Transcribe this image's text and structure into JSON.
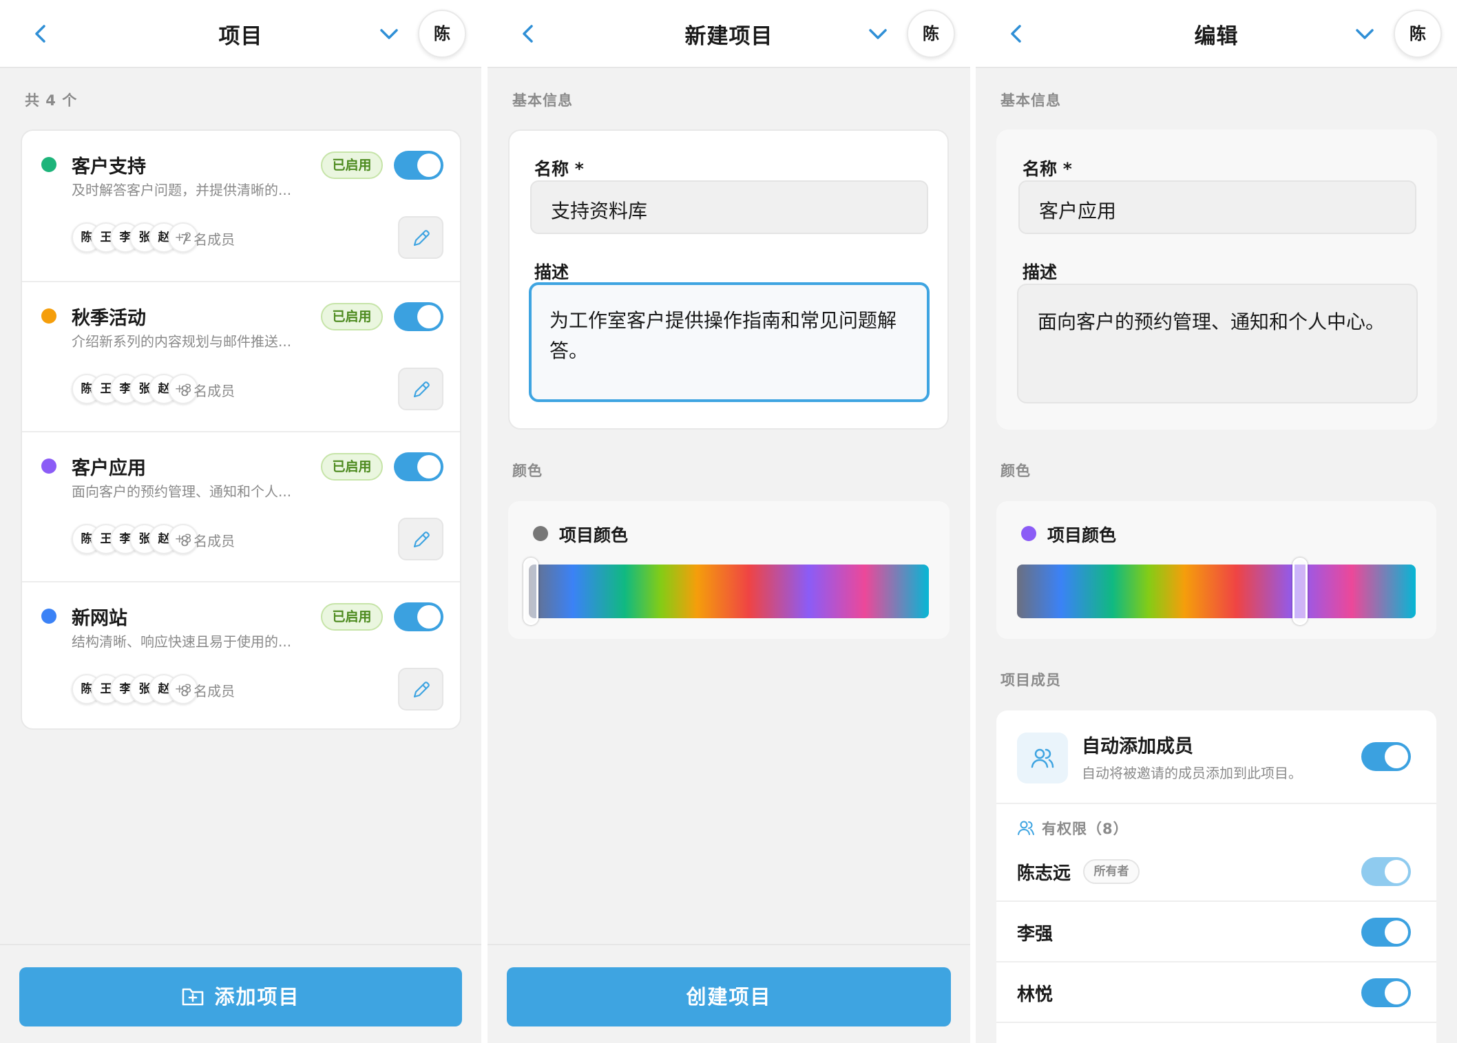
{
  "screens": {
    "list": {
      "title": "项目",
      "avatar": "陈",
      "count_label": "共 4 个",
      "projects": [
        {
          "name": "客户支持",
          "desc": "及时解答客户问题，并提供清晰的...",
          "status": "已启用",
          "color": "#1db47a",
          "avatars": [
            "陈",
            "王",
            "李",
            "张",
            "赵"
          ],
          "more": "+2",
          "members": "7 名成员"
        },
        {
          "name": "秋季活动",
          "desc": "介绍新系列的内容规划与邮件推送...",
          "status": "已启用",
          "color": "#f59e0b",
          "avatars": [
            "陈",
            "王",
            "李",
            "张",
            "赵"
          ],
          "more": "+3",
          "members": "8 名成员"
        },
        {
          "name": "客户应用",
          "desc": "面向客户的预约管理、通知和个人...",
          "status": "已启用",
          "color": "#8b5cf6",
          "avatars": [
            "陈",
            "王",
            "李",
            "张",
            "赵"
          ],
          "more": "+3",
          "members": "8 名成员"
        },
        {
          "name": "新网站",
          "desc": "结构清晰、响应快速且易于使用的...",
          "status": "已启用",
          "color": "#3b82f6",
          "avatars": [
            "陈",
            "王",
            "李",
            "张",
            "赵"
          ],
          "more": "+3",
          "members": "8 名成员"
        }
      ],
      "add_button": "添加项目"
    },
    "create": {
      "title": "新建项目",
      "avatar": "陈",
      "section_basic": "基本信息",
      "name_label": "名称 *",
      "name_value": "支持资料库",
      "desc_label": "描述",
      "desc_value": "为工作室客户提供操作指南和常见问题解答。",
      "section_color": "颜色",
      "color_label": "项目颜色",
      "color_dot": "#777777",
      "hue_position": 0.0,
      "create_button": "创建项目"
    },
    "edit": {
      "title": "编辑",
      "avatar": "陈",
      "section_basic": "基本信息",
      "name_label": "名称 *",
      "name_value": "客户应用",
      "desc_label": "描述",
      "desc_value": "面向客户的预约管理、通知和个人中心。",
      "section_color": "颜色",
      "color_label": "项目颜色",
      "color_dot": "#8b5cf6",
      "hue_position": 0.71,
      "section_members": "项目成员",
      "auto_add_title": "自动添加成员",
      "auto_add_sub": "自动将被邀请的成员添加到此项目。",
      "permission_label": "有权限（8）",
      "members": [
        {
          "name": "陈志远",
          "tag": "所有者"
        },
        {
          "name": "李强"
        },
        {
          "name": "林悦"
        }
      ]
    }
  },
  "colors": {
    "accent": "#3ea4e1",
    "enabled_badge": "#4c8a1e"
  }
}
